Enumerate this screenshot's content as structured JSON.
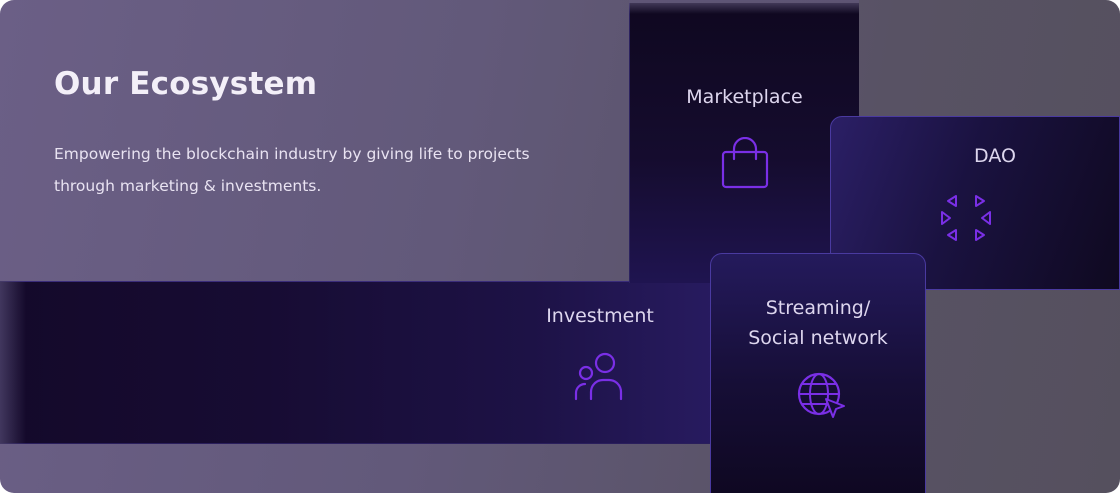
{
  "header": {
    "title": "Our Ecosystem",
    "subtitle": "Empowering the blockchain industry by giving life to projects through marketing & investments."
  },
  "cards": {
    "marketplace": {
      "label": "Marketplace",
      "icon": "shopping-bag-icon"
    },
    "dao": {
      "label": "DAO",
      "icon": "dao-arrows-icon"
    },
    "investment": {
      "label": "Investment",
      "icon": "users-icon"
    },
    "streaming": {
      "label_line1": "Streaming/",
      "label_line2": "Social network",
      "icon": "globe-cursor-icon"
    }
  },
  "colors": {
    "accent_icon": "#7a2fe6",
    "card_dark": "#150c2e",
    "background": "#62597a",
    "text_light": "#ddd6ee"
  }
}
